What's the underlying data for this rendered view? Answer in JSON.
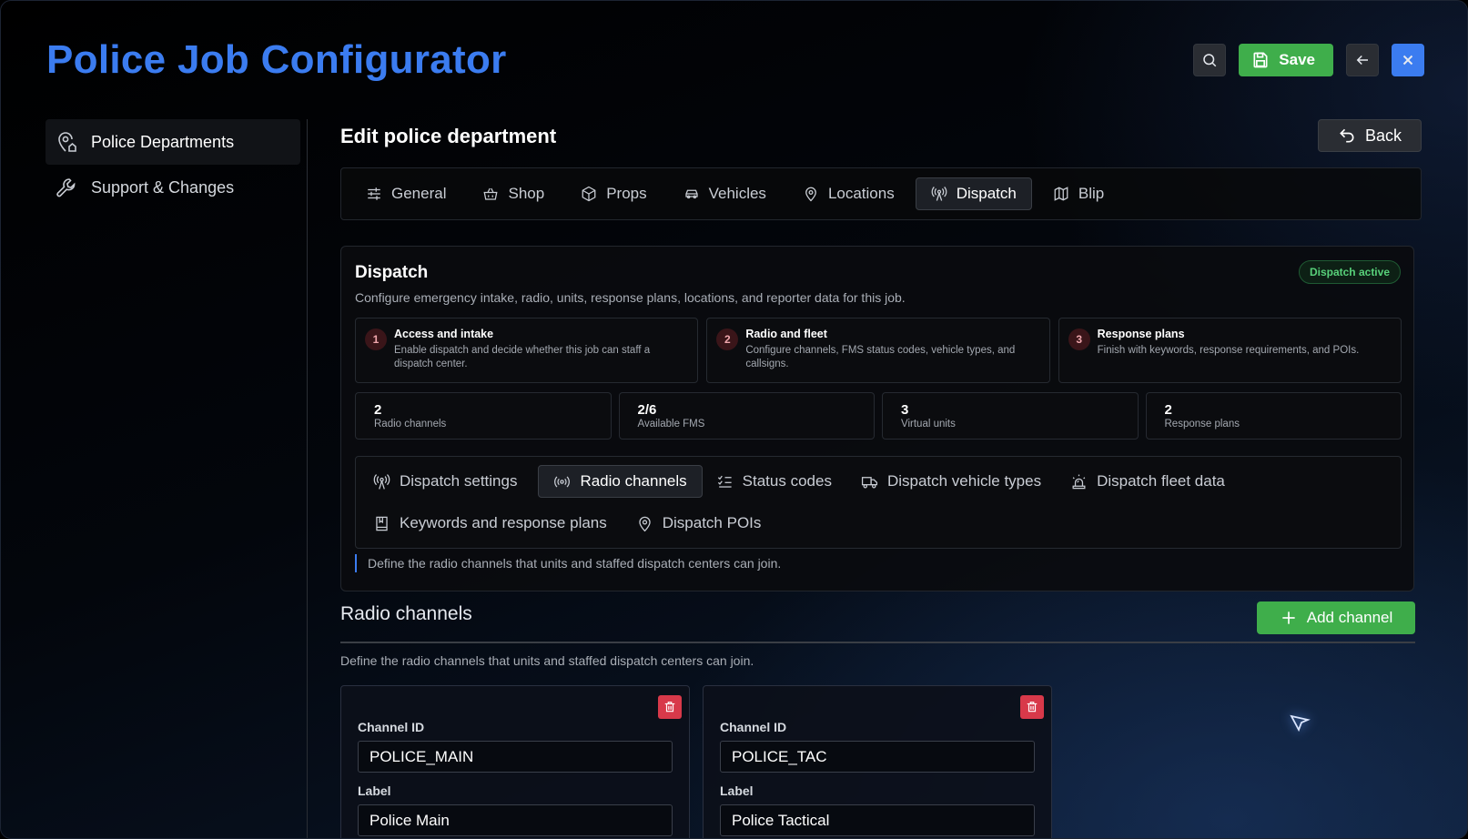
{
  "app": {
    "title": "Police Job Configurator"
  },
  "top_actions": {
    "save_label": "Save"
  },
  "sidebar": {
    "items": [
      {
        "label": "Police Departments",
        "icon": "map-pin-house-icon",
        "active": true
      },
      {
        "label": "Support & Changes",
        "icon": "wrench-icon",
        "active": false
      }
    ]
  },
  "page": {
    "title": "Edit police department",
    "back_label": "Back"
  },
  "tabs": [
    {
      "label": "General",
      "icon": "sliders-icon"
    },
    {
      "label": "Shop",
      "icon": "basket-icon"
    },
    {
      "label": "Props",
      "icon": "package-icon"
    },
    {
      "label": "Vehicles",
      "icon": "car-icon"
    },
    {
      "label": "Locations",
      "icon": "map-pin-icon"
    },
    {
      "label": "Dispatch",
      "icon": "radio-tower-icon",
      "active": true
    },
    {
      "label": "Blip",
      "icon": "map-icon"
    }
  ],
  "dispatch": {
    "title": "Dispatch",
    "subtitle": "Configure emergency intake, radio, units, response plans, locations, and reporter data for this job.",
    "status_badge": "Dispatch active",
    "steps": [
      {
        "num": "1",
        "title": "Access and intake",
        "desc": "Enable dispatch and decide whether this job can staff a dispatch center."
      },
      {
        "num": "2",
        "title": "Radio and fleet",
        "desc": "Configure channels, FMS status codes, vehicle types, and callsigns."
      },
      {
        "num": "3",
        "title": "Response plans",
        "desc": "Finish with keywords, response requirements, and POIs."
      }
    ],
    "stats": [
      {
        "value": "2",
        "label": "Radio channels"
      },
      {
        "value": "2/6",
        "label": "Available FMS"
      },
      {
        "value": "3",
        "label": "Virtual units"
      },
      {
        "value": "2",
        "label": "Response plans"
      }
    ],
    "subtabs": [
      {
        "label": "Dispatch settings",
        "icon": "radio-tower-icon"
      },
      {
        "label": "Radio channels",
        "icon": "radio-icon",
        "active": true
      },
      {
        "label": "Status codes",
        "icon": "list-checks-icon"
      },
      {
        "label": "Dispatch vehicle types",
        "icon": "truck-icon"
      },
      {
        "label": "Dispatch fleet data",
        "icon": "siren-icon"
      },
      {
        "label": "Keywords and response plans",
        "icon": "book-icon"
      },
      {
        "label": "Dispatch POIs",
        "icon": "map-pin-icon"
      }
    ],
    "hint": "Define the radio channels that units and staffed dispatch centers can join."
  },
  "radio_channels": {
    "title": "Radio channels",
    "add_label": "Add channel",
    "description": "Define the radio channels that units and staffed dispatch centers can join.",
    "channel_id_label": "Channel ID",
    "label_label": "Label",
    "channels": [
      {
        "id": "POLICE_MAIN",
        "label": "Police Main"
      },
      {
        "id": "POLICE_TAC",
        "label": "Police Tactical"
      }
    ]
  },
  "colors": {
    "accent": "#3b7cf0",
    "success": "#3fae4b",
    "danger": "#d8394a",
    "active_badge": "#58d17a"
  }
}
